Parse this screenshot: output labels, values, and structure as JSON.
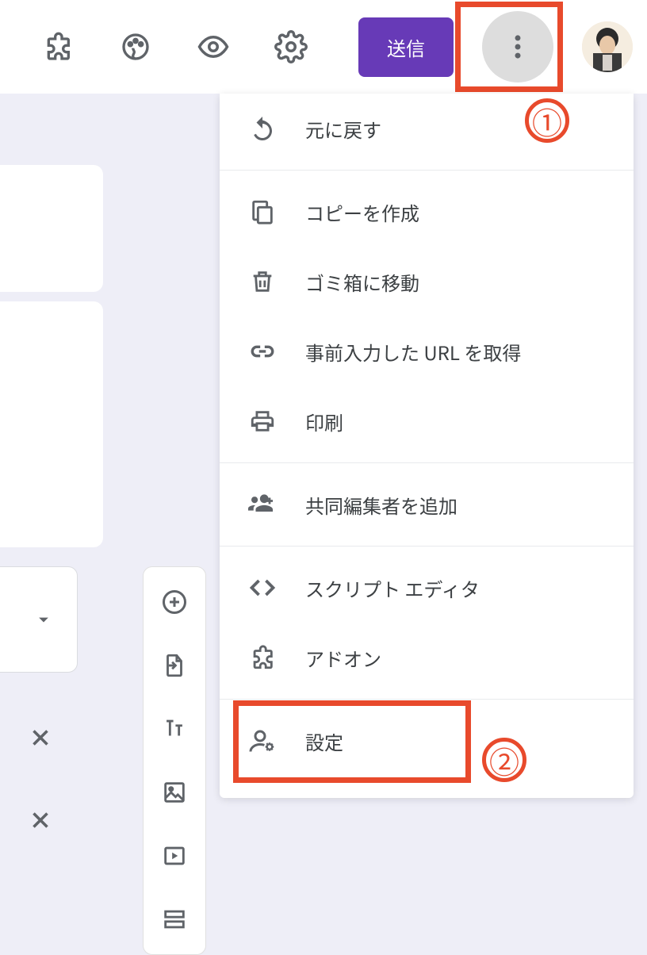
{
  "toolbar": {
    "send_label": "送信"
  },
  "menu": {
    "undo": "元に戻す",
    "make_copy": "コピーを作成",
    "move_to_trash": "ゴミ箱に移動",
    "get_prefilled_url": "事前入力した URL を取得",
    "print": "印刷",
    "add_collaborators": "共同編集者を追加",
    "script_editor": "スクリプト エディタ",
    "addons": "アドオン",
    "settings": "設定"
  },
  "annotations": {
    "one": "①",
    "two": "②"
  }
}
